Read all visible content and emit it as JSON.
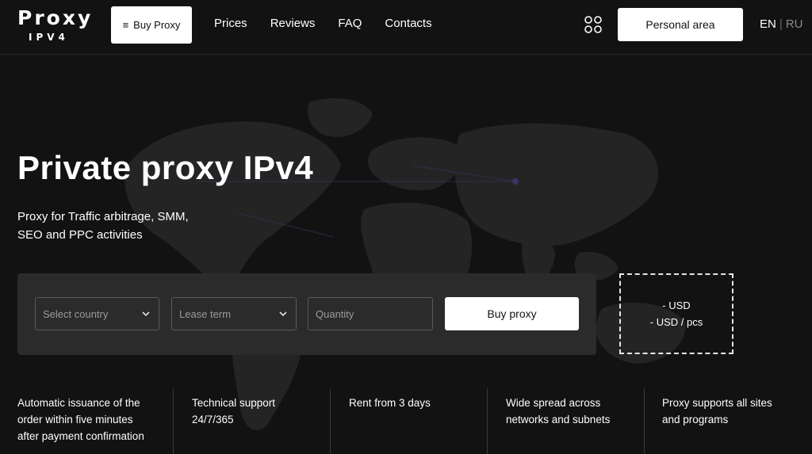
{
  "header": {
    "logo_top": "Proxy",
    "logo_bottom": "IPV4",
    "buy_proxy_label": "Buy Proxy",
    "nav": [
      "Prices",
      "Reviews",
      "FAQ",
      "Contacts"
    ],
    "personal_area_label": "Personal area",
    "lang_active": "EN",
    "lang_separator": "|",
    "lang_other": "RU"
  },
  "hero": {
    "title": "Private proxy IPv4",
    "subtitle_line1": "Proxy for Traffic arbitrage, SMM,",
    "subtitle_line2": "SEO and PPC activities"
  },
  "order": {
    "country_placeholder": "Select country",
    "lease_placeholder": "Lease term",
    "quantity_placeholder": "Quantity",
    "buy_label": "Buy proxy"
  },
  "price": {
    "total": "- USD",
    "per_piece": "- USD / pcs"
  },
  "features": [
    {
      "lines": [
        "Automatic issuance of the",
        "order within five minutes",
        "after payment confirmation"
      ]
    },
    {
      "lines": [
        "Technical support",
        "24/7/365"
      ]
    },
    {
      "lines": [
        "Rent from 3 days"
      ]
    },
    {
      "lines": [
        "Wide spread across",
        "networks and subnets"
      ]
    },
    {
      "lines": [
        "Proxy supports all sites",
        "and programs"
      ]
    }
  ],
  "icons": {
    "menu": "menu-icon",
    "apps": "apps-grid-icon",
    "chevron": "chevron-down-icon",
    "map": "world-map-icon"
  },
  "colors": {
    "background": "#121212",
    "panel": "#2b2b2b",
    "button": "#ffffff",
    "text": "#ffffff"
  }
}
